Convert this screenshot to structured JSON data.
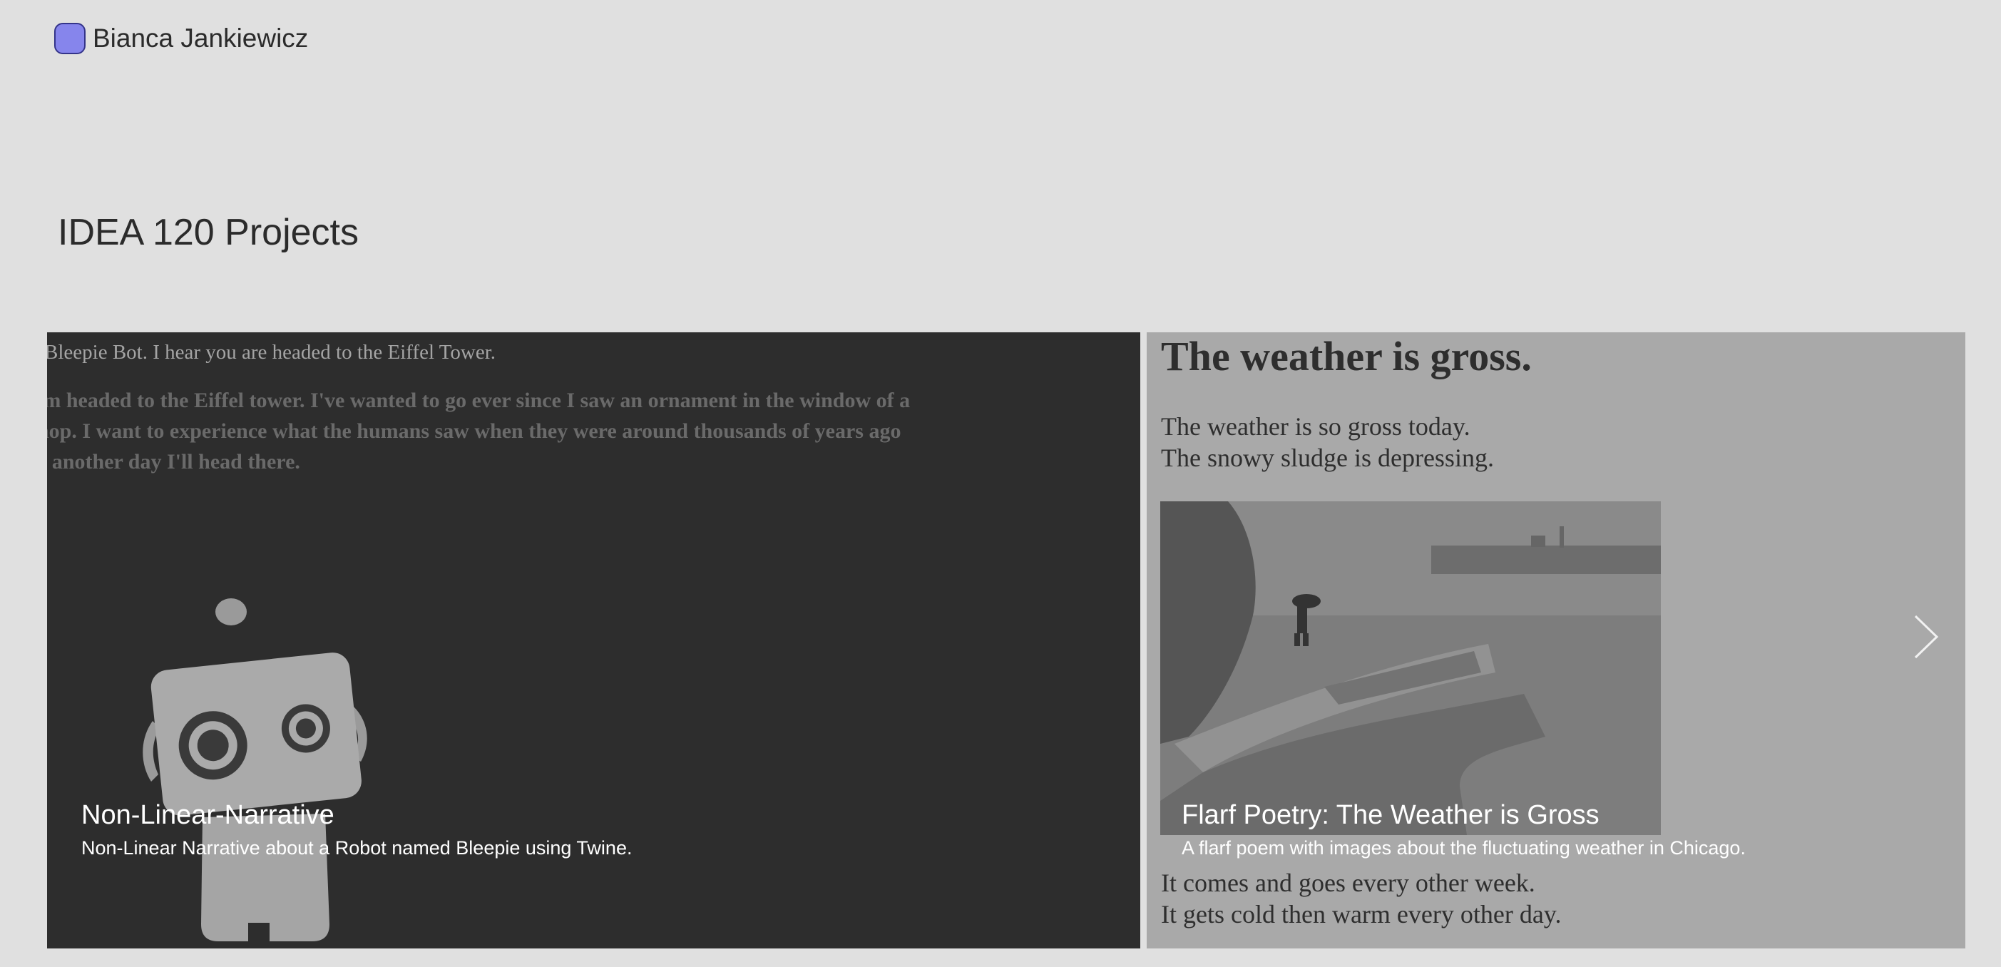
{
  "header": {
    "site_name": "Bianca Jankiewicz",
    "avatar_color": "#8685ec"
  },
  "page": {
    "title": "IDEA 120 Projects"
  },
  "carousel": {
    "slides": [
      {
        "title": "Non-Linear-Narrative",
        "description": "Non-Linear Narrative about a Robot named Bleepie using Twine.",
        "preview": {
          "line1": "Bleepie Bot. I hear you are headed to the Eiffel Tower.",
          "paragraph": "'m headed to the Eiffel tower. I've wanted to go ever since I saw an ornament in the window of a\nhop. I want to experience what the humans saw when they were around thousands of years ago\ne another day I'll head there.",
          "image_icon": "robot-illustration"
        }
      },
      {
        "title": "Flarf Poetry: The Weather is Gross",
        "description": "A flarf poem with images about the fluctuating weather in Chicago.",
        "preview": {
          "heading": "The weather is gross.",
          "lines_top": "The weather is so gross today.\nThe snowy sludge is depressing.",
          "lines_bottom": "It comes and goes every other week.\nIt gets cold then warm every other day.",
          "image_icon": "rainy-seawall-photo"
        }
      }
    ],
    "next_icon": "chevron-right-icon"
  }
}
